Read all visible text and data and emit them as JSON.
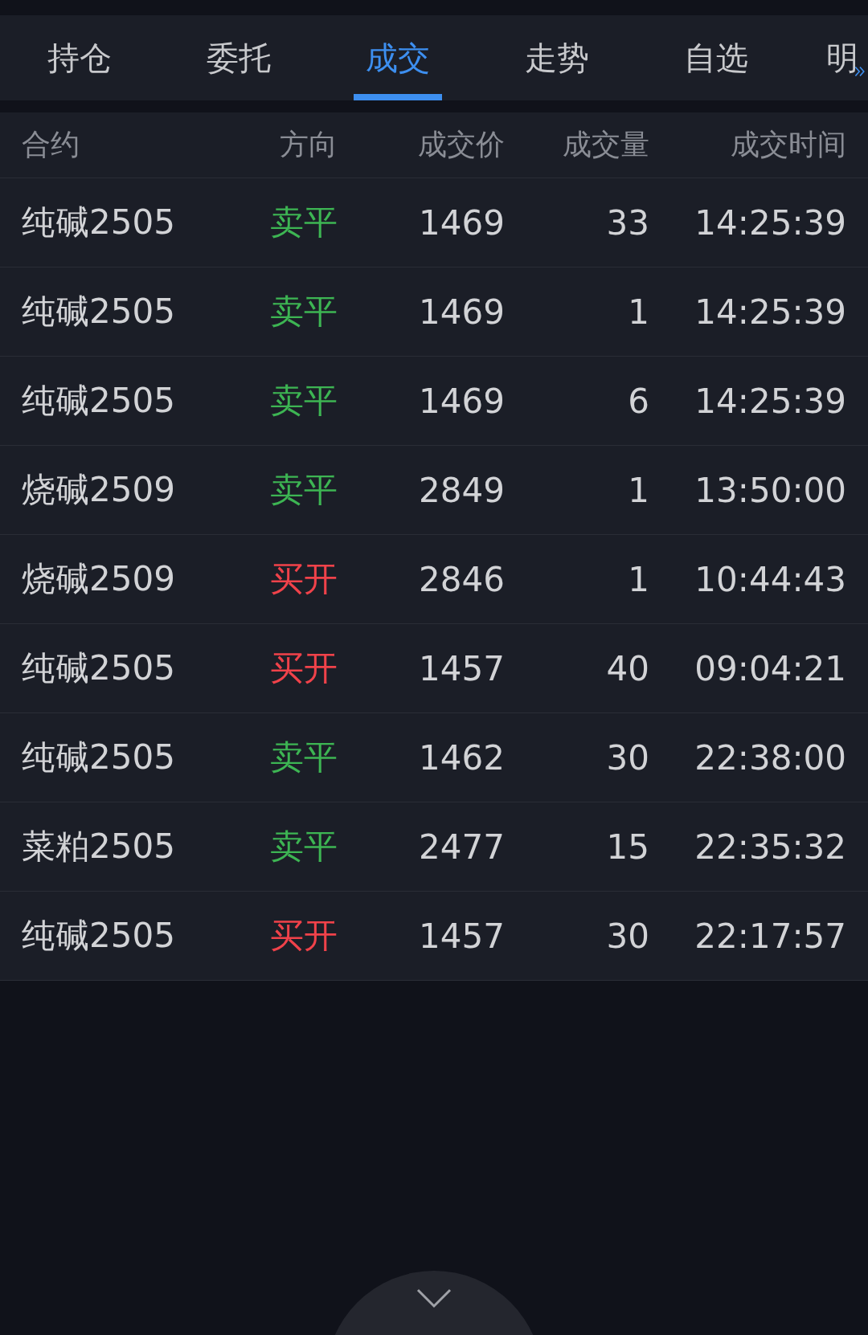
{
  "tabs": [
    {
      "label": "持仓",
      "selected": false
    },
    {
      "label": "委托",
      "selected": false
    },
    {
      "label": "成交",
      "selected": true
    },
    {
      "label": "走势",
      "selected": false
    },
    {
      "label": "自选",
      "selected": false
    },
    {
      "label": "明",
      "selected": false
    }
  ],
  "table": {
    "columns": [
      "合约",
      "方向",
      "成交价",
      "成交量",
      "成交时间"
    ],
    "rows": [
      {
        "contract": "纯碱2505",
        "direction": "卖平",
        "kind": "sell",
        "price": "1469",
        "volume": "33",
        "time": "14:25:39"
      },
      {
        "contract": "纯碱2505",
        "direction": "卖平",
        "kind": "sell",
        "price": "1469",
        "volume": "1",
        "time": "14:25:39"
      },
      {
        "contract": "纯碱2505",
        "direction": "卖平",
        "kind": "sell",
        "price": "1469",
        "volume": "6",
        "time": "14:25:39"
      },
      {
        "contract": "烧碱2509",
        "direction": "卖平",
        "kind": "sell",
        "price": "2849",
        "volume": "1",
        "time": "13:50:00"
      },
      {
        "contract": "烧碱2509",
        "direction": "买开",
        "kind": "buy",
        "price": "2846",
        "volume": "1",
        "time": "10:44:43"
      },
      {
        "contract": "纯碱2505",
        "direction": "买开",
        "kind": "buy",
        "price": "1457",
        "volume": "40",
        "time": "09:04:21"
      },
      {
        "contract": "纯碱2505",
        "direction": "卖平",
        "kind": "sell",
        "price": "1462",
        "volume": "30",
        "time": "22:38:00"
      },
      {
        "contract": "菜粕2505",
        "direction": "卖平",
        "kind": "sell",
        "price": "2477",
        "volume": "15",
        "time": "22:35:32"
      },
      {
        "contract": "纯碱2505",
        "direction": "买开",
        "kind": "buy",
        "price": "1457",
        "volume": "30",
        "time": "22:17:57"
      }
    ]
  }
}
